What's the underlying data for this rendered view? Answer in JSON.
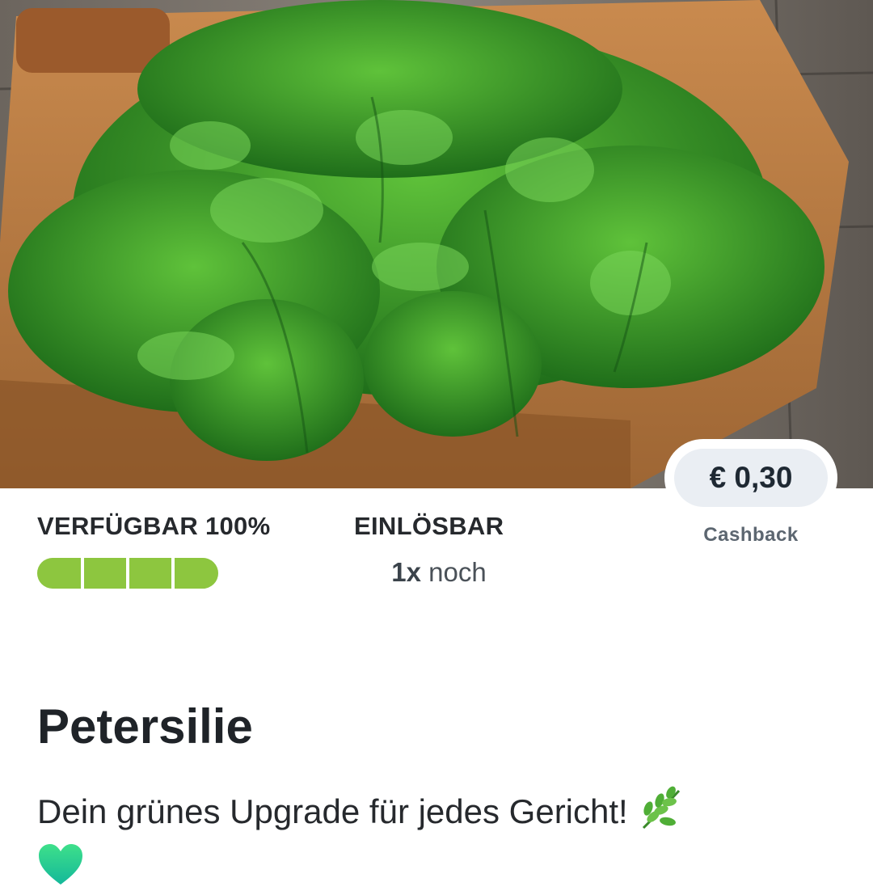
{
  "product": {
    "image": "parsley-on-cutting-board-photo",
    "title": "Petersilie",
    "description": "Dein grünes Upgrade für jedes Gericht!",
    "description_icons": [
      "herb-icon",
      "green-heart-icon"
    ]
  },
  "cashback": {
    "amount": "€ 0,30",
    "label": "Cashback"
  },
  "availability": {
    "label": "VERFÜGBAR 100%",
    "level": 1.0,
    "segments": 4,
    "bar_color": "#8DC63F"
  },
  "redeemable": {
    "label": "EINLÖSBAR",
    "count": "1x",
    "suffix": "noch"
  }
}
